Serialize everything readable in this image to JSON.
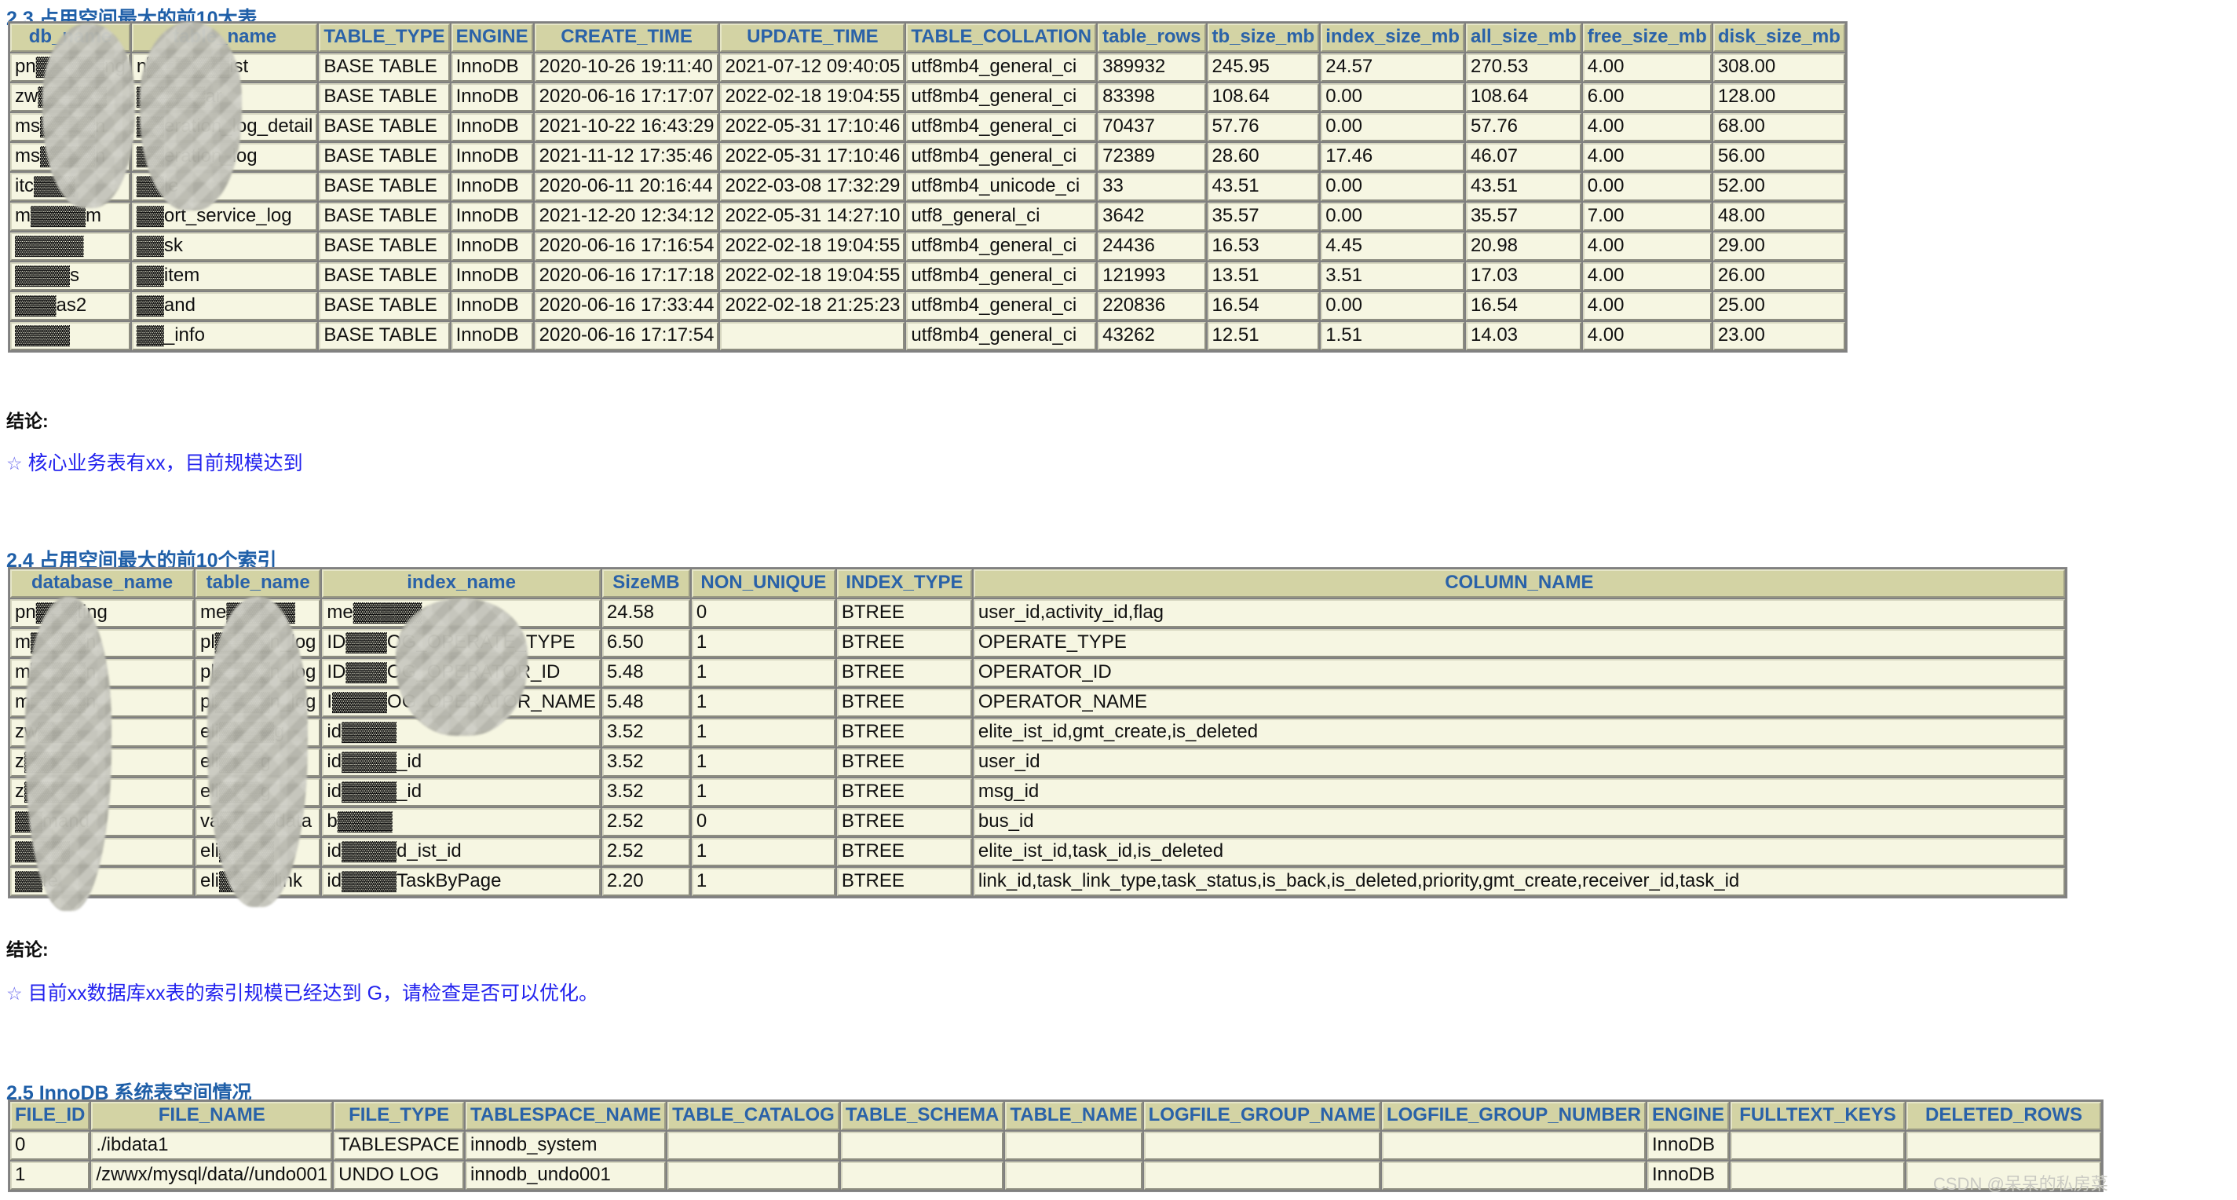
{
  "sections": {
    "s23": {
      "heading": "2.3 占用空间最大的前10大表",
      "columns": [
        "db_name",
        "table_name",
        "TABLE_TYPE",
        "ENGINE",
        "CREATE_TIME",
        "UPDATE_TIME",
        "TABLE_COLLATION",
        "table_rows",
        "tb_size_mb",
        "index_size_mb",
        "all_size_mb",
        "free_size_mb",
        "disk_size_mb"
      ],
      "rows": [
        [
          "pn▓▓▓▓▓ng",
          "n▓▓▓▓▓▓ist",
          "BASE TABLE",
          "InnoDB",
          "2020-10-26 19:11:40",
          "2021-07-12 09:40:05",
          "utf8mb4_general_ci",
          "389932",
          "245.95",
          "24.57",
          "270.53",
          "4.00",
          "308.00"
        ],
        [
          "zw▓▓▓▓▓",
          "▓▓▓▓▓ar",
          "BASE TABLE",
          "InnoDB",
          "2020-06-16 17:17:07",
          "2022-02-18 19:04:55",
          "utf8mb4_general_ci",
          "83398",
          "108.64",
          "0.00",
          "108.64",
          "6.00",
          "128.00"
        ],
        [
          "ms▓▓▓▓n",
          "▓▓eration_log_detail",
          "BASE TABLE",
          "InnoDB",
          "2021-10-22 16:43:29",
          "2022-05-31 17:10:46",
          "utf8mb4_general_ci",
          "70437",
          "57.76",
          "0.00",
          "57.76",
          "4.00",
          "68.00"
        ],
        [
          "ms▓▓▓▓n",
          "▓▓eration_log",
          "BASE TABLE",
          "InnoDB",
          "2021-11-12 17:35:46",
          "2022-05-31 17:10:46",
          "utf8mb4_general_ci",
          "72389",
          "28.60",
          "17.46",
          "46.07",
          "4.00",
          "56.00"
        ],
        [
          "itc▓▓▓",
          "▓▓le",
          "BASE TABLE",
          "InnoDB",
          "2020-06-11 20:16:44",
          "2022-03-08 17:32:29",
          "utf8mb4_unicode_ci",
          "33",
          "43.51",
          "0.00",
          "43.51",
          "0.00",
          "52.00"
        ],
        [
          "m▓▓▓▓m",
          "▓▓ort_service_log",
          "BASE TABLE",
          "InnoDB",
          "2021-12-20 12:34:12",
          "2022-05-31 14:27:10",
          "utf8_general_ci",
          "3642",
          "35.57",
          "0.00",
          "35.57",
          "7.00",
          "48.00"
        ],
        [
          "▓▓▓▓▓",
          "▓▓sk",
          "BASE TABLE",
          "InnoDB",
          "2020-06-16 17:16:54",
          "2022-02-18 19:04:55",
          "utf8mb4_general_ci",
          "24436",
          "16.53",
          "4.45",
          "20.98",
          "4.00",
          "29.00"
        ],
        [
          "▓▓▓▓s",
          "▓▓item",
          "BASE TABLE",
          "InnoDB",
          "2020-06-16 17:17:18",
          "2022-02-18 19:04:55",
          "utf8mb4_general_ci",
          "121993",
          "13.51",
          "3.51",
          "17.03",
          "4.00",
          "26.00"
        ],
        [
          "▓▓▓as2",
          "▓▓and",
          "BASE TABLE",
          "InnoDB",
          "2020-06-16 17:33:44",
          "2022-02-18 21:25:23",
          "utf8mb4_general_ci",
          "220836",
          "16.54",
          "0.00",
          "16.54",
          "4.00",
          "25.00"
        ],
        [
          "▓▓▓▓",
          "▓▓_info",
          "BASE TABLE",
          "InnoDB",
          "2020-06-16 17:17:54",
          "",
          "utf8mb4_general_ci",
          "43262",
          "12.51",
          "1.51",
          "14.03",
          "4.00",
          "23.00"
        ]
      ],
      "conclusion_label": "结论:",
      "conclusion_text": "核心业务表有xx，目前规模达到",
      "conclusion_star": "☆"
    },
    "s24": {
      "heading": "2.4 占用空间最大的前10个索引",
      "columns": [
        "database_name",
        "table_name",
        "index_name",
        "SizeMB",
        "NON_UNIQUE",
        "INDEX_TYPE",
        "COLUMN_NAME"
      ],
      "rows": [
        [
          "pn▓▓▓ting",
          "me▓▓▓▓▓",
          "me▓▓▓▓▓",
          "24.58",
          "0",
          "BTREE",
          "user_id,activity_id,flag"
        ],
        [
          "m▓▓▓▓n",
          "pl▓▓▓▓n_log",
          "ID▓▓▓OG_OPERATE_TYPE",
          "6.50",
          "1",
          "BTREE",
          "OPERATE_TYPE"
        ],
        [
          "m▓▓▓▓n",
          "pl▓▓▓▓n_log",
          "ID▓▓▓OG_OPERATOR_ID",
          "5.48",
          "1",
          "BTREE",
          "OPERATOR_ID"
        ],
        [
          "m▓▓▓▓n",
          "pl▓▓▓▓n_log",
          "I▓▓▓▓OG_OPERATOR_NAME",
          "5.48",
          "1",
          "BTREE",
          "OPERATOR_NAME"
        ],
        [
          "zw▓▓▓",
          "eli▓▓▓▓g",
          "id▓▓▓▓",
          "3.52",
          "1",
          "BTREE",
          "elite_ist_id,gmt_create,is_deleted"
        ],
        [
          "z▓▓▓▓",
          "eli▓▓▓g",
          "id▓▓▓▓_id",
          "3.52",
          "1",
          "BTREE",
          "user_id"
        ],
        [
          "z▓▓▓▓",
          "eli▓▓▓g",
          "id▓▓▓▓_id",
          "3.52",
          "1",
          "BTREE",
          "msg_id"
        ],
        [
          "▓▓mand",
          "va▓▓▓▓data",
          "b▓▓▓▓",
          "2.52",
          "0",
          "BTREE",
          "bus_id"
        ],
        [
          "▓▓▓▓",
          "eli▓▓▓▓",
          "id▓▓▓▓d_ist_id",
          "2.52",
          "1",
          "BTREE",
          "elite_ist_id,task_id,is_deleted"
        ],
        [
          "▓▓te",
          "eli▓▓▓▓link",
          "id▓▓▓▓TaskByPage",
          "2.20",
          "1",
          "BTREE",
          "link_id,task_link_type,task_status,is_back,is_deleted,priority,gmt_create,receiver_id,task_id"
        ]
      ],
      "conclusion_label": "结论:",
      "conclusion_text": "目前xx数据库xx表的索引规模已经达到 G，请检查是否可以优化。",
      "conclusion_star": "☆"
    },
    "s25": {
      "heading": "2.5 InnoDB 系统表空间情况",
      "columns": [
        "FILE_ID",
        "FILE_NAME",
        "FILE_TYPE",
        "TABLESPACE_NAME",
        "TABLE_CATALOG",
        "TABLE_SCHEMA",
        "TABLE_NAME",
        "LOGFILE_GROUP_NAME",
        "LOGFILE_GROUP_NUMBER",
        "ENGINE",
        "FULLTEXT_KEYS",
        "DELETED_ROWS"
      ],
      "rows": [
        [
          "0",
          "./ibdata1",
          "TABLESPACE",
          "innodb_system",
          "",
          "",
          "",
          "",
          "",
          "InnoDB",
          "",
          ""
        ],
        [
          "1",
          "/zwwx/mysql/data//undo001",
          "UNDO LOG",
          "innodb_undo001",
          "",
          "",
          "",
          "",
          "",
          "InnoDB",
          "",
          ""
        ]
      ]
    }
  },
  "watermark": "CSDN @呆呆的私房菜",
  "colors": {
    "heading": "#1f5fa8",
    "header_bg": "#d3d3a4",
    "header_text": "#2a62a8",
    "cell_bg": "#f6f6e2",
    "conclusion_text": "#2222ee"
  }
}
